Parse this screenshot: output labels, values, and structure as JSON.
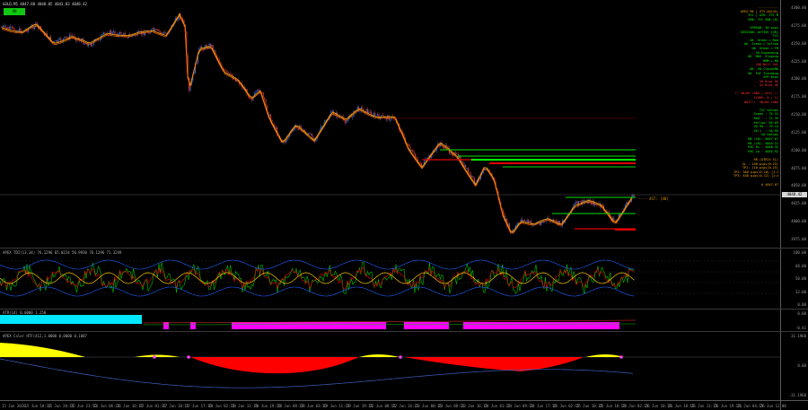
{
  "chart": {
    "symbol_line": "GOLD,M5  4047.88 4048.05 4043.83 4048.42",
    "badge": "ON",
    "current_price": "4048.42",
    "target_label": "---- 4ST: [40]",
    "colors": {
      "bg": "#000000",
      "candle_up": "#3a6fd8",
      "candle_down": "#d83a3a",
      "ma_fast": "#f0a000",
      "ma_slow": "#ff6a00",
      "level_green": "#00e000",
      "level_red": "#e00000",
      "grid": "#2a2a2a"
    }
  },
  "price_axis": [
    "4300.00",
    "4275.00",
    "4250.00",
    "4225.00",
    "4200.00",
    "4175.00",
    "4150.00",
    "4125.00",
    "4100.00",
    "4075.00",
    "4050.00",
    "4025.00",
    "4000.00",
    "3975.00"
  ],
  "panel": {
    "lines": [
      {
        "text": "-----------",
        "color": "#f0a000"
      },
      {
        "text": "APEX M5 | XTY:40(45)",
        "color": "#f0a000"
      },
      {
        "text": "TCC | ATR: TCC M",
        "color": "#00ff00"
      },
      {
        "text": "SMA: TCC SMA (H)",
        "color": "#00ff00"
      },
      {
        "text": "",
        "color": "#00ff00"
      },
      {
        "text": "SPREAD: 36 pips",
        "color": "#00ff00"
      },
      {
        "text": "SESSION: ACTIVE [3R]",
        "color": "#00ff00"
      },
      {
        "text": "TCC",
        "color": "#00ff00"
      },
      {
        "text": "OK  Green > Red",
        "color": "#00ff00"
      },
      {
        "text": "OK  Green > Yellow",
        "color": "#00ff00"
      },
      {
        "text": "OK  Green > TM",
        "color": "#00ff00"
      },
      {
        "text": "-- VO Expanding",
        "color": "#00ff00"
      },
      {
        "text": "OK  MAS  Sloping",
        "color": "#00ff00"
      },
      {
        "text": "HMM + MA",
        "color": "#00ff00"
      },
      {
        "text": "-- 288 Bull Val",
        "color": "#ff3030"
      },
      {
        "text": "OK  VO Cloud/MA",
        "color": "#00ff00"
      },
      {
        "text": "OK  FAC Trending",
        "color": "#00ff00"
      },
      {
        "text": "VPP Bias",
        "color": "#00ff00"
      },
      {
        "text": "-- 5H Bias OK",
        "color": "#ff3030"
      },
      {
        "text": "-- 5X Bias OK",
        "color": "#ff3030"
      },
      {
        "text": "",
        "color": "#00ff00"
      },
      {
        "text": "!! XB/60 LONG (-Set) !!",
        "color": "#ff3030"
      },
      {
        "text": "SCORE: 8 / 11",
        "color": "#ff3030"
      },
      {
        "text": "WAIT!!  XB/60 LONG",
        "color": "#ff3030"
      },
      {
        "text": "",
        "color": "#00ff00"
      },
      {
        "text": "TCC Values",
        "color": "#00ff00"
      },
      {
        "text": "Green : 75.31",
        "color": "#00ff00"
      },
      {
        "text": "Red   : 71.35",
        "color": "#00ff00"
      },
      {
        "text": "Yellow: 65.69",
        "color": "#00ff00"
      },
      {
        "text": "VO 95 : 79.14",
        "color": "#00ff00"
      },
      {
        "text": "VO 1  : 16.95",
        "color": "#00ff00"
      },
      {
        "text": "VA Values",
        "color": "#00ff00"
      },
      {
        "text": "MA (10): 4047.67",
        "color": "#00ff00"
      },
      {
        "text": "MA (18): 4045.21",
        "color": "#00ff00"
      },
      {
        "text": "PAC Hi : 4048.32",
        "color": "#00ff00"
      },
      {
        "text": "PAC Lo : 4045.92",
        "color": "#00ff00"
      },
      {
        "text": "",
        "color": "#00ff00"
      },
      {
        "text": "RR (ATR2X SL)",
        "color": "#f0a000"
      },
      {
        "text": "SL : 150 pips(0.25)",
        "color": "#f0a000"
      },
      {
        "text": "TP1: 110 pips(0.25)",
        "color": "#f0a000"
      },
      {
        "text": "TP2: 300 pips(0.18) [1:2]",
        "color": "#f0a000"
      },
      {
        "text": "TP3: 640 pips(0.12) [1:4R]",
        "color": "#f0a000"
      },
      {
        "text": "",
        "color": "#f0a000"
      },
      {
        "text": "@ 4047.67",
        "color": "#f0a000"
      }
    ]
  },
  "pane2": {
    "title": "APEX TDI(13,34)  76.1296  65.0224  56.9930  76.1296  71.3249",
    "axis": [
      "100.00",
      "68.00",
      "50.00",
      "32.00",
      "0.00"
    ]
  },
  "pane3": {
    "title": "ATR(14)  0.0000  1.250",
    "axis": [
      "0.00",
      "-0.41"
    ]
  },
  "pane4": {
    "title": "APEX Color HTF(412,1.0000  0.0000  0.1887",
    "axis": [
      "31.1960",
      "0.00",
      "-31.1960"
    ]
  },
  "time_axis": [
    "15 Jun 2026",
    "15 Jun 10:15",
    "15 Jun 20:15",
    "15 Jun 23:55",
    "16 Jun 06:15",
    "16 Jun 16:15",
    "17 Jun 01:15",
    "17 Jun 10:15",
    "17 Jun 17:15",
    "18 Jun 02:15",
    "18 Jun 11:15",
    "18 Jun 19:15",
    "18 Jun 08:15",
    "19 Jun 03:15",
    "19 Jun 11:15",
    "19 Jun 19:15",
    "22 Jun 08:15",
    "22 Jun 16:15",
    "23 Jun 00:15",
    "23 Jun 08:15",
    "23 Jun 16:15",
    "24 Jun 01:15",
    "24 Jun 09:15",
    "24 Jun 17:15",
    "25 Jun 02:15",
    "25 Jun 10:15",
    "25 Jun 18:15",
    "26 Jun 02:15",
    "26 Jun 10:15",
    "26 Jun 18:15",
    "26 Jun 11:15",
    "26 Jun 19:15",
    "26 Jun 04:15",
    "26 Jun 12:00"
  ]
}
